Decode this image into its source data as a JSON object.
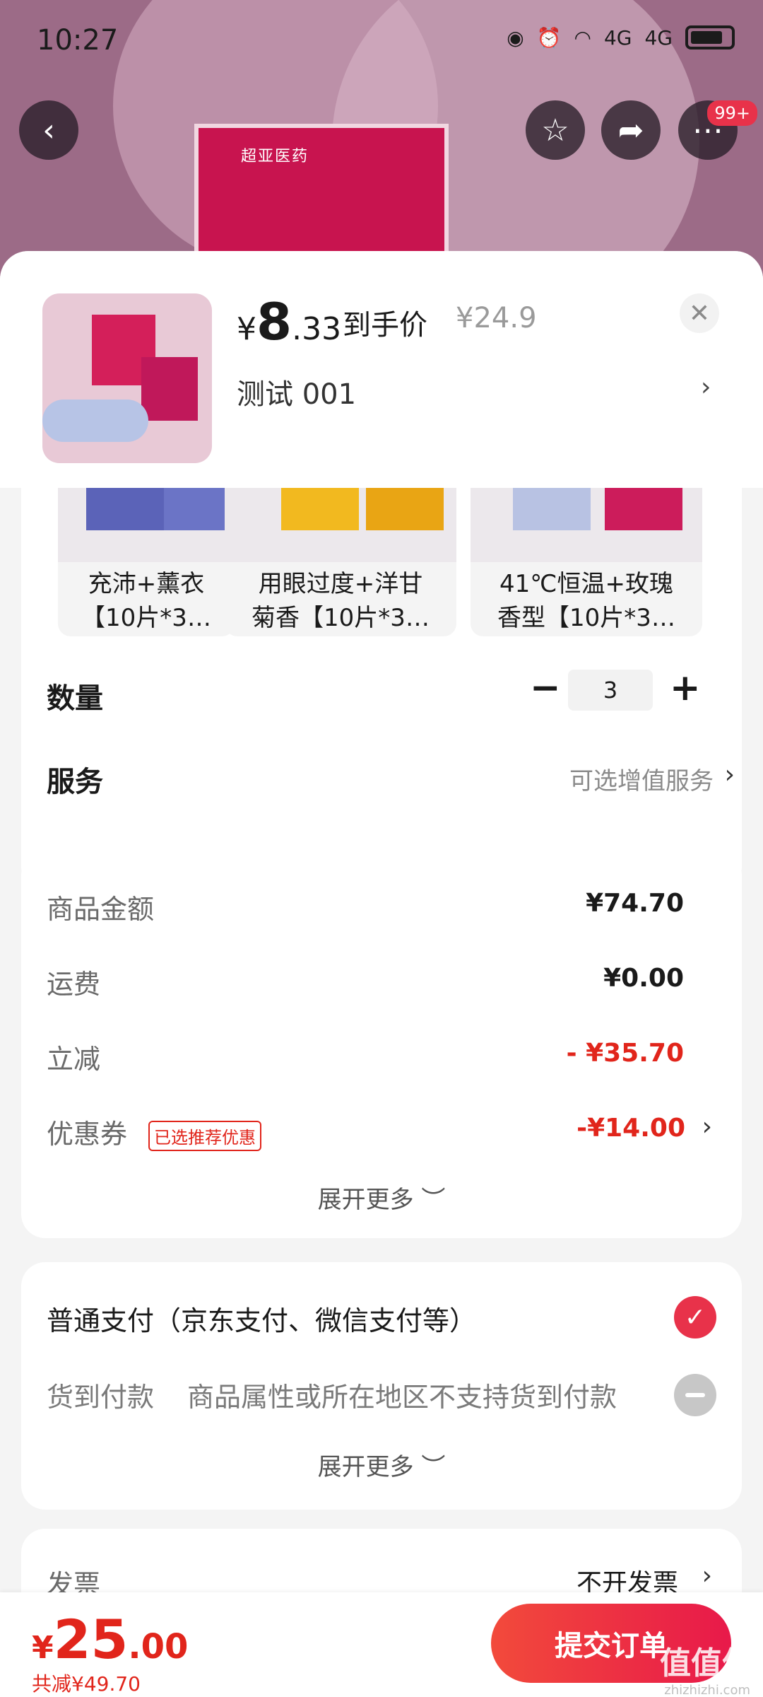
{
  "status_bar": {
    "time": "10:27",
    "signal_1": "4G",
    "signal_2": "4G"
  },
  "top_nav": {
    "more_badge": "99+"
  },
  "product_box_label": "超亚医药",
  "sku_header": {
    "price_currency": "¥",
    "price_int": "8",
    "price_dec": ".33",
    "price_tag": "到手价",
    "original_price": "¥24.9",
    "selected_spec": "测试  001"
  },
  "variants": [
    {
      "text": "充沛+薰衣\n【10片*3…"
    },
    {
      "text": "用眼过度+洋甘\n菊香【10片*3…"
    },
    {
      "text": "41℃恒温+玫瑰\n香型【10片*3…"
    }
  ],
  "quantity": {
    "label": "数量",
    "value": "3"
  },
  "service": {
    "label": "服务",
    "value": "可选增值服务"
  },
  "amounts": {
    "goods_label": "商品金额",
    "goods_value": "¥74.70",
    "shipping_label": "运费",
    "shipping_value": "¥0.00",
    "discount_label": "立减",
    "discount_value": "- ¥35.70",
    "coupon_label": "优惠券",
    "coupon_tag": "已选推荐优惠",
    "coupon_value": "-¥14.00",
    "expand": "展开更多 ︶"
  },
  "payment": {
    "normal": "普通支付（京东支付、微信支付等）",
    "cod": "货到付款",
    "cod_note": "商品属性或所在地区不支持货到付款",
    "expand": "展开更多 ︶"
  },
  "invoice": {
    "label": "发票",
    "value": "不开发票"
  },
  "bottom": {
    "total_currency": "¥",
    "total_int": "25",
    "total_dec": ".00",
    "saved": "共减¥49.70",
    "submit": "提交订单",
    "watermark": "值值值",
    "watermark_sub": "zhizhizhi.com"
  },
  "colors": {
    "accent_red": "#e1251b",
    "button_red": "#e8194a"
  }
}
